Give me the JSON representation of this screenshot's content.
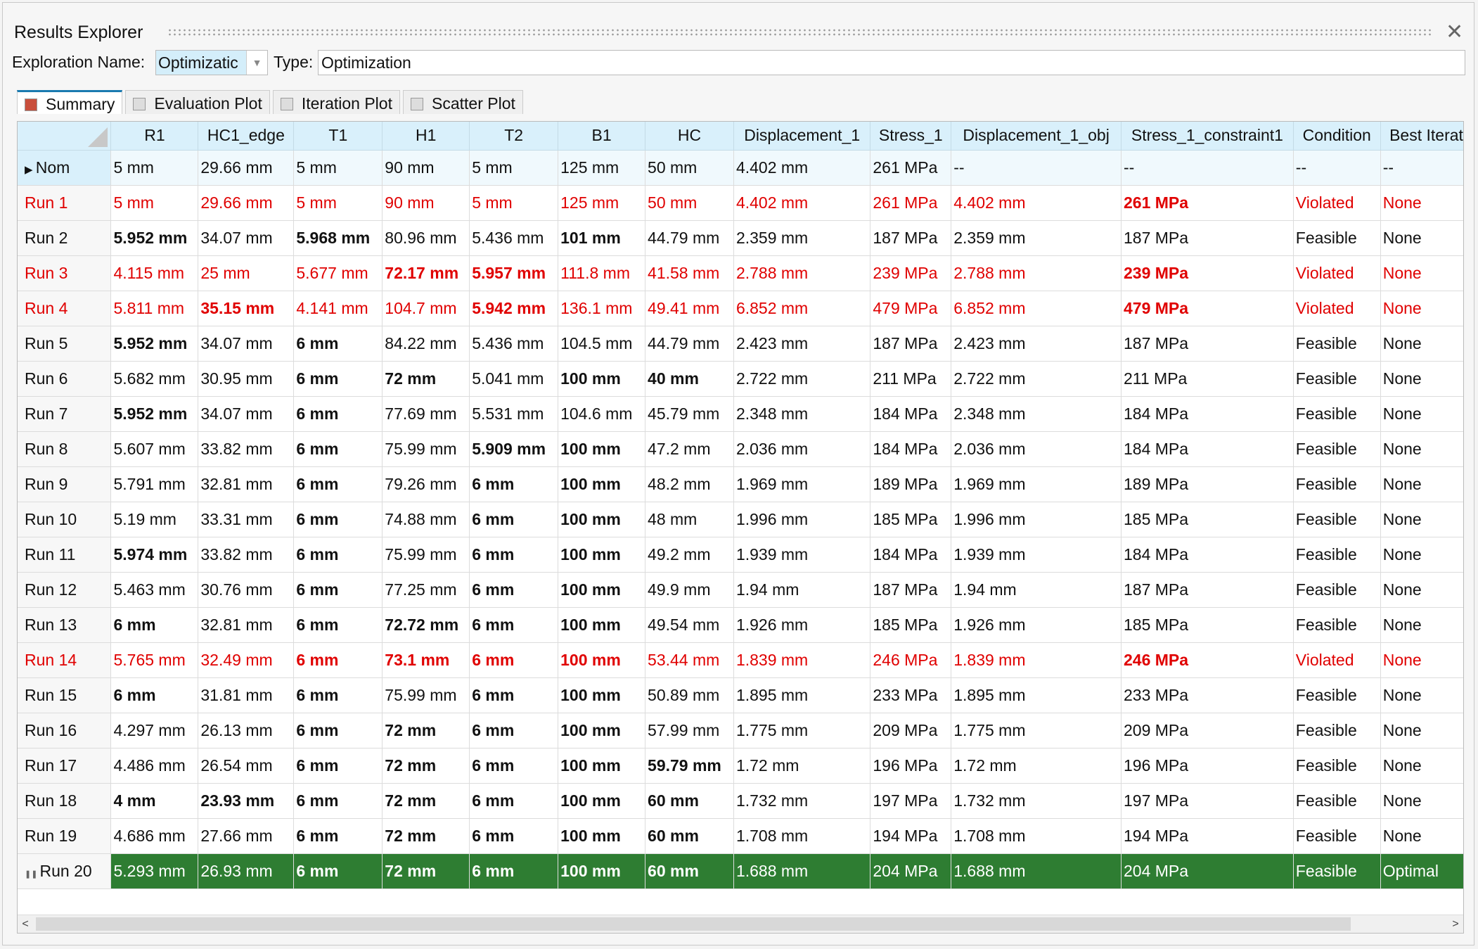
{
  "window": {
    "title": "Results Explorer",
    "close_icon": "close-icon"
  },
  "exploration": {
    "name_label": "Exploration Name:",
    "name_value": "Optimizatic",
    "type_label": "Type:",
    "type_value": "Optimization"
  },
  "tabs": [
    {
      "label": "Summary",
      "icon": "table-icon",
      "active": true
    },
    {
      "label": "Evaluation Plot",
      "icon": "evaluation-plot-icon"
    },
    {
      "label": "Iteration Plot",
      "icon": "iteration-plot-icon"
    },
    {
      "label": "Scatter Plot",
      "icon": "scatter-plot-icon"
    }
  ],
  "colors": {
    "violated": "#e00000",
    "optimal_row": "#2e7d32",
    "header": "#d9f0fb"
  },
  "columns": [
    "R1",
    "HC1_edge",
    "T1",
    "H1",
    "T2",
    "B1",
    "HC",
    "Displacement_1",
    "Stress_1",
    "Displacement_1_obj",
    "Stress_1_constraint1",
    "Condition",
    "Best Iteration"
  ],
  "rows": [
    {
      "name": "Nom",
      "status": "nominal",
      "cells": [
        "5 mm",
        "29.66 mm",
        "5 mm",
        "90 mm",
        "5 mm",
        "125 mm",
        "50 mm",
        "4.402 mm",
        "261 MPa",
        "--",
        "--",
        "--",
        "--"
      ],
      "bold": []
    },
    {
      "name": "Run 1",
      "status": "violated",
      "cells": [
        "5 mm",
        "29.66 mm",
        "5 mm",
        "90 mm",
        "5 mm",
        "125 mm",
        "50 mm",
        "4.402 mm",
        "261 MPa",
        "4.402 mm",
        "261 MPa",
        "Violated",
        "None"
      ],
      "bold": [
        10
      ]
    },
    {
      "name": "Run 2",
      "status": "feasible",
      "cells": [
        "5.952 mm",
        "34.07 mm",
        "5.968 mm",
        "80.96 mm",
        "5.436 mm",
        "101 mm",
        "44.79 mm",
        "2.359 mm",
        "187 MPa",
        "2.359 mm",
        "187 MPa",
        "Feasible",
        "None"
      ],
      "bold": [
        0,
        2,
        5
      ]
    },
    {
      "name": "Run 3",
      "status": "violated",
      "cells": [
        "4.115 mm",
        "25 mm",
        "5.677 mm",
        "72.17 mm",
        "5.957 mm",
        "111.8 mm",
        "41.58 mm",
        "2.788 mm",
        "239 MPa",
        "2.788 mm",
        "239 MPa",
        "Violated",
        "None"
      ],
      "bold": [
        3,
        4,
        10
      ]
    },
    {
      "name": "Run 4",
      "status": "violated",
      "cells": [
        "5.811 mm",
        "35.15 mm",
        "4.141 mm",
        "104.7 mm",
        "5.942 mm",
        "136.1 mm",
        "49.41 mm",
        "6.852 mm",
        "479 MPa",
        "6.852 mm",
        "479 MPa",
        "Violated",
        "None"
      ],
      "bold": [
        1,
        4,
        10
      ]
    },
    {
      "name": "Run 5",
      "status": "feasible",
      "cells": [
        "5.952 mm",
        "34.07 mm",
        "6 mm",
        "84.22 mm",
        "5.436 mm",
        "104.5 mm",
        "44.79 mm",
        "2.423 mm",
        "187 MPa",
        "2.423 mm",
        "187 MPa",
        "Feasible",
        "None"
      ],
      "bold": [
        0,
        2
      ]
    },
    {
      "name": "Run 6",
      "status": "feasible",
      "cells": [
        "5.682 mm",
        "30.95 mm",
        "6 mm",
        "72 mm",
        "5.041 mm",
        "100 mm",
        "40 mm",
        "2.722 mm",
        "211 MPa",
        "2.722 mm",
        "211 MPa",
        "Feasible",
        "None"
      ],
      "bold": [
        2,
        3,
        5,
        6
      ]
    },
    {
      "name": "Run 7",
      "status": "feasible",
      "cells": [
        "5.952 mm",
        "34.07 mm",
        "6 mm",
        "77.69 mm",
        "5.531 mm",
        "104.6 mm",
        "45.79 mm",
        "2.348 mm",
        "184 MPa",
        "2.348 mm",
        "184 MPa",
        "Feasible",
        "None"
      ],
      "bold": [
        0,
        2
      ]
    },
    {
      "name": "Run 8",
      "status": "feasible",
      "cells": [
        "5.607 mm",
        "33.82 mm",
        "6 mm",
        "75.99 mm",
        "5.909 mm",
        "100 mm",
        "47.2 mm",
        "2.036 mm",
        "184 MPa",
        "2.036 mm",
        "184 MPa",
        "Feasible",
        "None"
      ],
      "bold": [
        2,
        4,
        5
      ]
    },
    {
      "name": "Run 9",
      "status": "feasible",
      "cells": [
        "5.791 mm",
        "32.81 mm",
        "6 mm",
        "79.26 mm",
        "6 mm",
        "100 mm",
        "48.2 mm",
        "1.969 mm",
        "189 MPa",
        "1.969 mm",
        "189 MPa",
        "Feasible",
        "None"
      ],
      "bold": [
        2,
        4,
        5
      ]
    },
    {
      "name": "Run 10",
      "status": "feasible",
      "cells": [
        "5.19 mm",
        "33.31 mm",
        "6 mm",
        "74.88 mm",
        "6 mm",
        "100 mm",
        "48 mm",
        "1.996 mm",
        "185 MPa",
        "1.996 mm",
        "185 MPa",
        "Feasible",
        "None"
      ],
      "bold": [
        2,
        4,
        5
      ]
    },
    {
      "name": "Run 11",
      "status": "feasible",
      "cells": [
        "5.974 mm",
        "33.82 mm",
        "6 mm",
        "75.99 mm",
        "6 mm",
        "100 mm",
        "49.2 mm",
        "1.939 mm",
        "184 MPa",
        "1.939 mm",
        "184 MPa",
        "Feasible",
        "None"
      ],
      "bold": [
        0,
        2,
        4,
        5
      ]
    },
    {
      "name": "Run 12",
      "status": "feasible",
      "cells": [
        "5.463 mm",
        "30.76 mm",
        "6 mm",
        "77.25 mm",
        "6 mm",
        "100 mm",
        "49.9 mm",
        "1.94 mm",
        "187 MPa",
        "1.94 mm",
        "187 MPa",
        "Feasible",
        "None"
      ],
      "bold": [
        2,
        4,
        5
      ]
    },
    {
      "name": "Run 13",
      "status": "feasible",
      "cells": [
        "6 mm",
        "32.81 mm",
        "6 mm",
        "72.72 mm",
        "6 mm",
        "100 mm",
        "49.54 mm",
        "1.926 mm",
        "185 MPa",
        "1.926 mm",
        "185 MPa",
        "Feasible",
        "None"
      ],
      "bold": [
        0,
        2,
        3,
        4,
        5
      ]
    },
    {
      "name": "Run 14",
      "status": "violated",
      "cells": [
        "5.765 mm",
        "32.49 mm",
        "6 mm",
        "73.1 mm",
        "6 mm",
        "100 mm",
        "53.44 mm",
        "1.839 mm",
        "246 MPa",
        "1.839 mm",
        "246 MPa",
        "Violated",
        "None"
      ],
      "bold": [
        2,
        3,
        4,
        5,
        10
      ]
    },
    {
      "name": "Run 15",
      "status": "feasible",
      "cells": [
        "6 mm",
        "31.81 mm",
        "6 mm",
        "75.99 mm",
        "6 mm",
        "100 mm",
        "50.89 mm",
        "1.895 mm",
        "233 MPa",
        "1.895 mm",
        "233 MPa",
        "Feasible",
        "None"
      ],
      "bold": [
        0,
        2,
        4,
        5
      ]
    },
    {
      "name": "Run 16",
      "status": "feasible",
      "cells": [
        "4.297 mm",
        "26.13 mm",
        "6 mm",
        "72 mm",
        "6 mm",
        "100 mm",
        "57.99 mm",
        "1.775 mm",
        "209 MPa",
        "1.775 mm",
        "209 MPa",
        "Feasible",
        "None"
      ],
      "bold": [
        2,
        3,
        4,
        5
      ]
    },
    {
      "name": "Run 17",
      "status": "feasible",
      "cells": [
        "4.486 mm",
        "26.54 mm",
        "6 mm",
        "72 mm",
        "6 mm",
        "100 mm",
        "59.79 mm",
        "1.72 mm",
        "196 MPa",
        "1.72 mm",
        "196 MPa",
        "Feasible",
        "None"
      ],
      "bold": [
        2,
        3,
        4,
        5,
        6
      ]
    },
    {
      "name": "Run 18",
      "status": "feasible",
      "cells": [
        "4 mm",
        "23.93 mm",
        "6 mm",
        "72 mm",
        "6 mm",
        "100 mm",
        "60 mm",
        "1.732 mm",
        "197 MPa",
        "1.732 mm",
        "197 MPa",
        "Feasible",
        "None"
      ],
      "bold": [
        0,
        1,
        2,
        3,
        4,
        5,
        6
      ]
    },
    {
      "name": "Run 19",
      "status": "feasible",
      "cells": [
        "4.686 mm",
        "27.66 mm",
        "6 mm",
        "72 mm",
        "6 mm",
        "100 mm",
        "60 mm",
        "1.708 mm",
        "194 MPa",
        "1.708 mm",
        "194 MPa",
        "Feasible",
        "None"
      ],
      "bold": [
        2,
        3,
        4,
        5,
        6
      ]
    },
    {
      "name": "Run 20",
      "status": "optimal",
      "cells": [
        "5.293 mm",
        "26.93 mm",
        "6 mm",
        "72 mm",
        "6 mm",
        "100 mm",
        "60 mm",
        "1.688 mm",
        "204 MPa",
        "1.688 mm",
        "204 MPa",
        "Feasible",
        "Optimal"
      ],
      "bold": [
        2,
        3,
        4,
        5,
        6
      ]
    }
  ]
}
